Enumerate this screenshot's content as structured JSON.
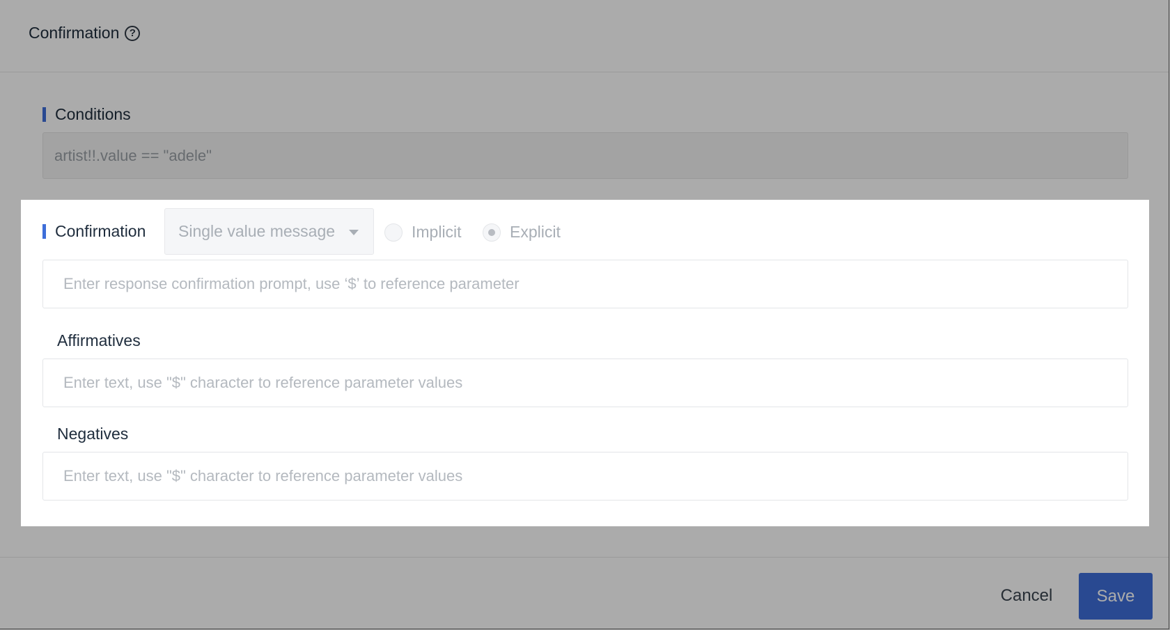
{
  "dialog": {
    "title": "Confirmation"
  },
  "conditions": {
    "label": "Conditions",
    "expression": "artist!!.value == \"adele\""
  },
  "confirmation": {
    "label": "Confirmation",
    "type_select": {
      "selected": "Single value message"
    },
    "mode": {
      "options": [
        "Implicit",
        "Explicit"
      ],
      "selected": "Explicit"
    },
    "prompt_placeholder": "Enter response confirmation prompt, use ‘$’ to reference parameter",
    "affirmatives": {
      "label": "Affirmatives",
      "placeholder": "Enter text, use \"$\" character to reference parameter values"
    },
    "negatives": {
      "label": "Negatives",
      "placeholder": "Enter text, use \"$\" character to reference parameter values"
    }
  },
  "footer": {
    "cancel_label": "Cancel",
    "save_label": "Save"
  },
  "colors": {
    "accent": "#3e6ed9",
    "overlay": "rgba(0,0,0,0.33)"
  },
  "icons": {
    "help": "question-circle-icon",
    "dropdown": "caret-down-icon"
  }
}
